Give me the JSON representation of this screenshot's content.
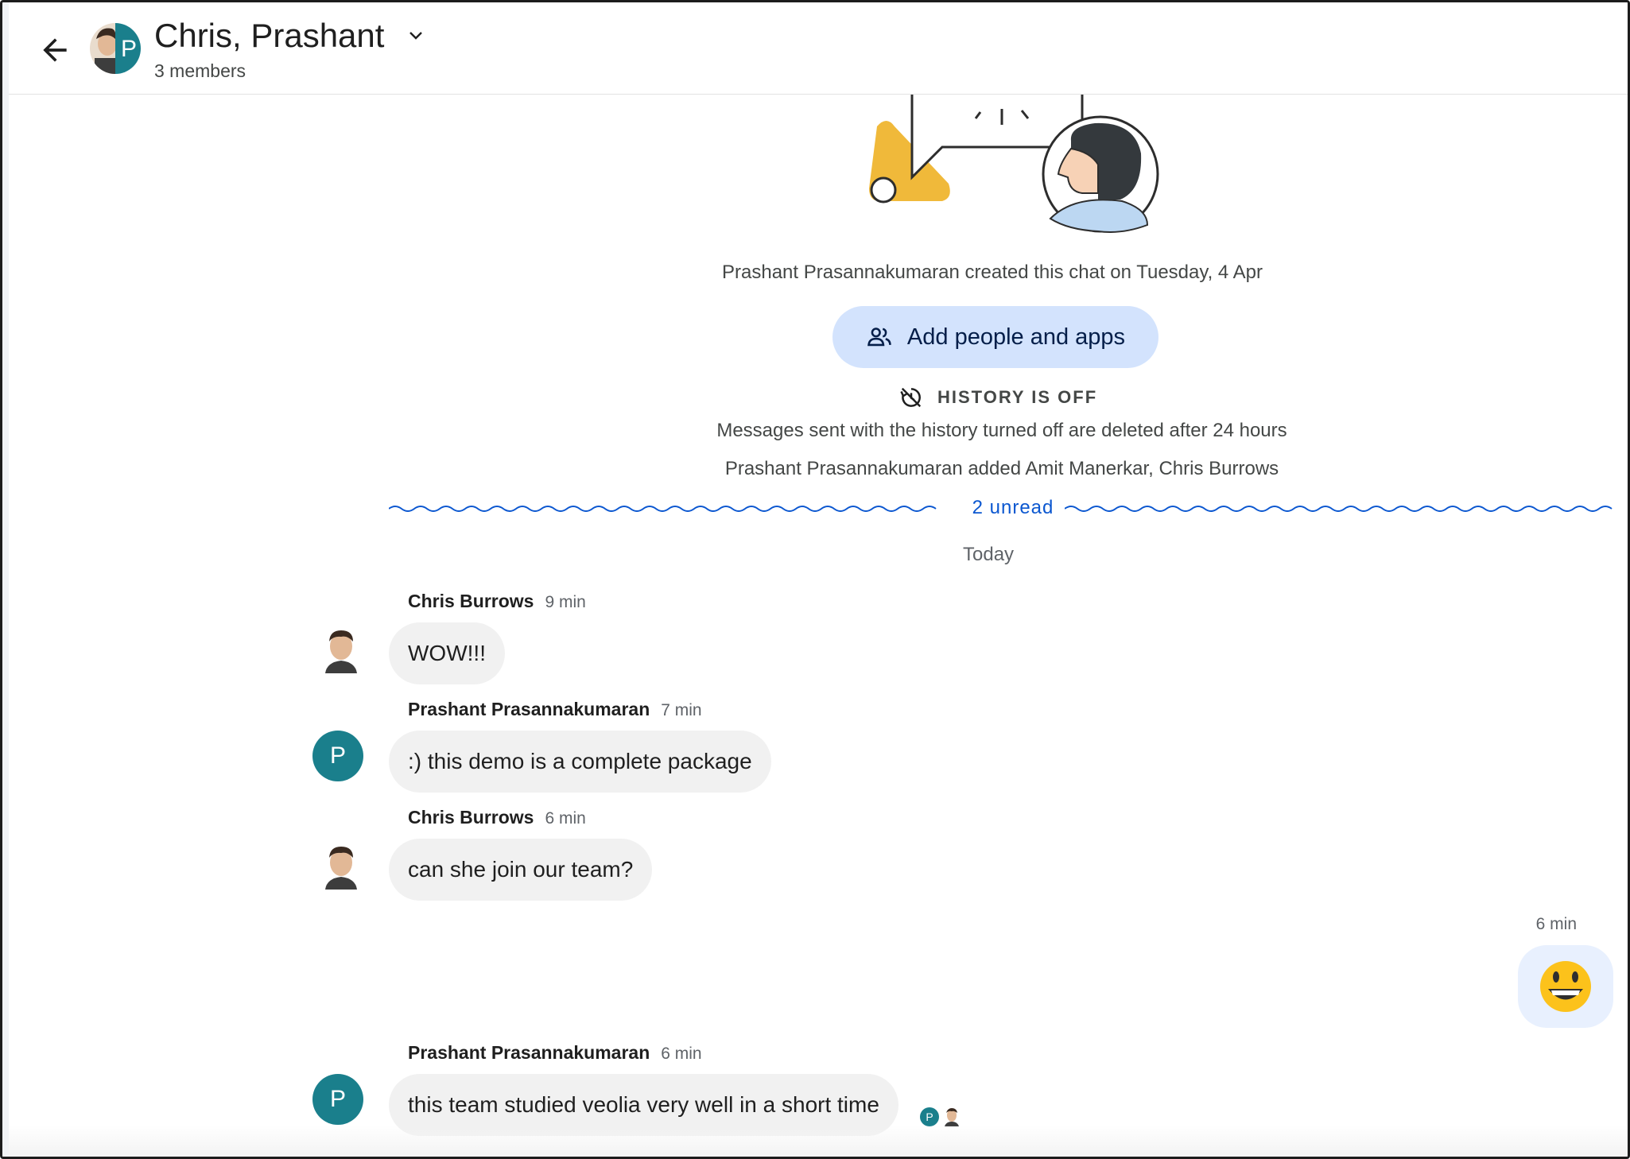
{
  "header": {
    "title": "Chris, Prashant",
    "members": "3 members",
    "avatar_initial": "P"
  },
  "info": {
    "created": "Prashant Prasannakumaran created this chat on Tuesday, 4 Apr",
    "add_button": "Add people and apps",
    "history_title": "HISTORY IS OFF",
    "history_desc": "Messages sent with the history turned off are deleted after 24 hours",
    "added": "Prashant Prasannakumaran added Amit Manerkar, Chris Burrows",
    "unread": "2 unread",
    "date_divider": "Today"
  },
  "messages": [
    {
      "sender": "Chris Burrows",
      "time": "9 min",
      "text": "WOW!!!",
      "avatar": "photo"
    },
    {
      "sender": "Prashant Prasannakumaran",
      "time": "7 min",
      "text": ":) this demo is a complete package",
      "avatar": "P"
    },
    {
      "sender": "Chris Burrows",
      "time": "6 min",
      "text": "can she join our team?",
      "avatar": "photo"
    },
    {
      "sender": "",
      "time": "6 min",
      "text": "😀",
      "avatar": ""
    },
    {
      "sender": "Prashant Prasannakumaran",
      "time": "6 min",
      "text": "this team studied veolia very well in a short time",
      "avatar": "P"
    }
  ],
  "colors": {
    "accent": "#0b57d0",
    "add_button_bg": "#d3e3fd",
    "avatar_teal": "#1a7f8c",
    "bubble_bg": "#f1f1f1",
    "self_bubble_bg": "#e8f0fe",
    "illustration_yellow": "#f0b93a"
  },
  "icons": {
    "back": "arrow-left-icon",
    "chevron": "chevron-down-icon",
    "add_people": "people-icon",
    "history": "history-off-icon",
    "emoji": "grinning-face-emoji"
  }
}
